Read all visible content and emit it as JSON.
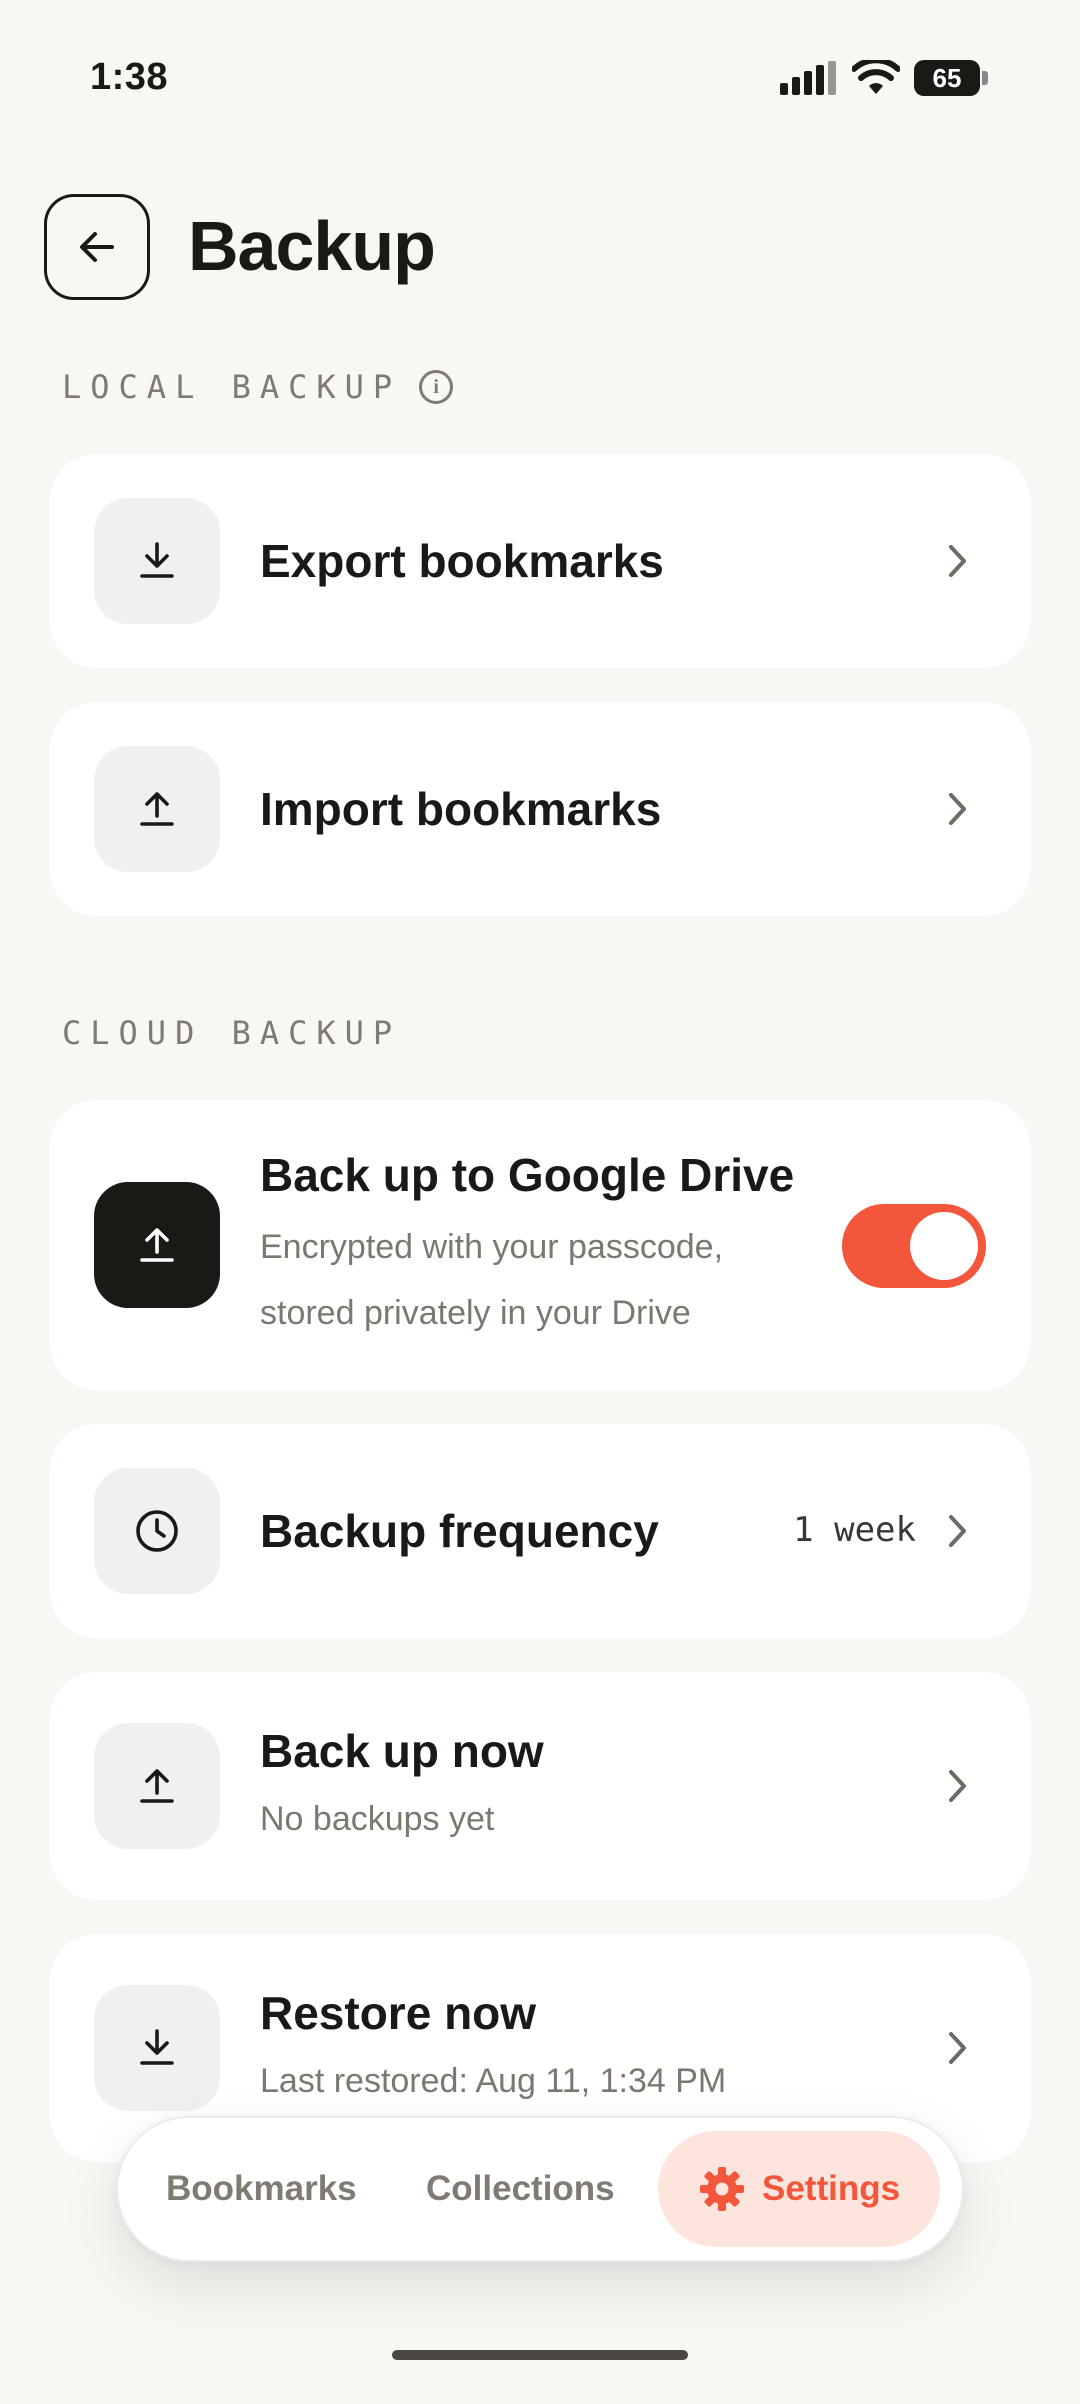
{
  "status_bar": {
    "time": "1:38",
    "battery": "65"
  },
  "header": {
    "title": "Backup",
    "back_icon": "arrow-left-icon"
  },
  "local_backup": {
    "label": "LOCAL BACKUP",
    "items": [
      {
        "label": "Export bookmarks",
        "icon": "download-icon"
      },
      {
        "label": "Import bookmarks",
        "icon": "upload-icon"
      }
    ]
  },
  "cloud_backup": {
    "label": "CLOUD BACKUP",
    "drive": {
      "title": "Back up to Google Drive",
      "subtitle_line1": "Encrypted with your passcode,",
      "subtitle_line2": "stored privately in your Drive",
      "enabled": true
    },
    "frequency": {
      "label": "Backup frequency",
      "value": "1 week"
    },
    "backup_now": {
      "label": "Back up now",
      "subtitle": "No backups yet"
    },
    "restore_now": {
      "label": "Restore now",
      "subtitle": "Last restored: Aug 11, 1:34 PM"
    }
  },
  "bottom_nav": {
    "items": [
      {
        "label": "Bookmarks",
        "active": false
      },
      {
        "label": "Collections",
        "active": false
      },
      {
        "label": "Settings",
        "active": true,
        "icon": "gear-icon"
      }
    ]
  },
  "colors": {
    "accent": "#f3563a",
    "background": "#f8f7f4",
    "card": "#ffffff",
    "text": "#1b1916",
    "muted": "#7d786f"
  }
}
